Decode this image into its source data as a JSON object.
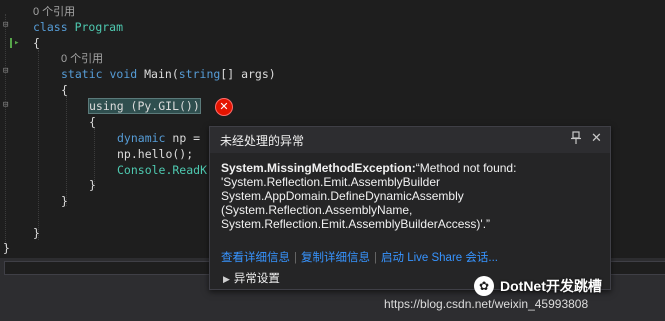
{
  "editor": {
    "ref_count_1": "0 个引用",
    "class_kw": "class",
    "class_name": "Program",
    "open_brace": "{",
    "ref_count_2": "0 个引用",
    "static_kw": "static",
    "void_kw": "void",
    "main_sig": "Main(",
    "string_kw": "string",
    "main_sig_end": "[] args)",
    "using_line": "using (Py.GIL())",
    "inner_open": "{",
    "dynamic_kw": "dynamic",
    "np_decl": "np = ",
    "np_hello": "np.hello();",
    "console_line": "Console.ReadK",
    "inner_close": "}",
    "method_close": "}",
    "class_close": "}",
    "ns_close": "}"
  },
  "popup": {
    "title": "未经处理的异常",
    "pin_icon": "pin-icon",
    "close_icon": "close-icon",
    "exception_type": "System.MissingMethodException:",
    "exception_msg": "“Method not found: 'System.Reflection.Emit.AssemblyBuilder System.AppDomain.DefineDynamicAssembly (System.Reflection.AssemblyName, System.Reflection.Emit.AssemblyBuilderAccess)'.”",
    "link_details": "查看详细信息",
    "link_copy": "复制详细信息",
    "link_liveshare": "启动 Live Share 会话...",
    "settings_label": "异常设置"
  },
  "watermark": {
    "brand": "DotNet开发跳槽",
    "url": "https://blog.csdn.net/weixin_45993808"
  },
  "colors": {
    "background": "#1e1e1e",
    "keyword": "#569cd6",
    "type": "#4ec9b0",
    "link": "#3794ff",
    "error": "#e51400"
  }
}
